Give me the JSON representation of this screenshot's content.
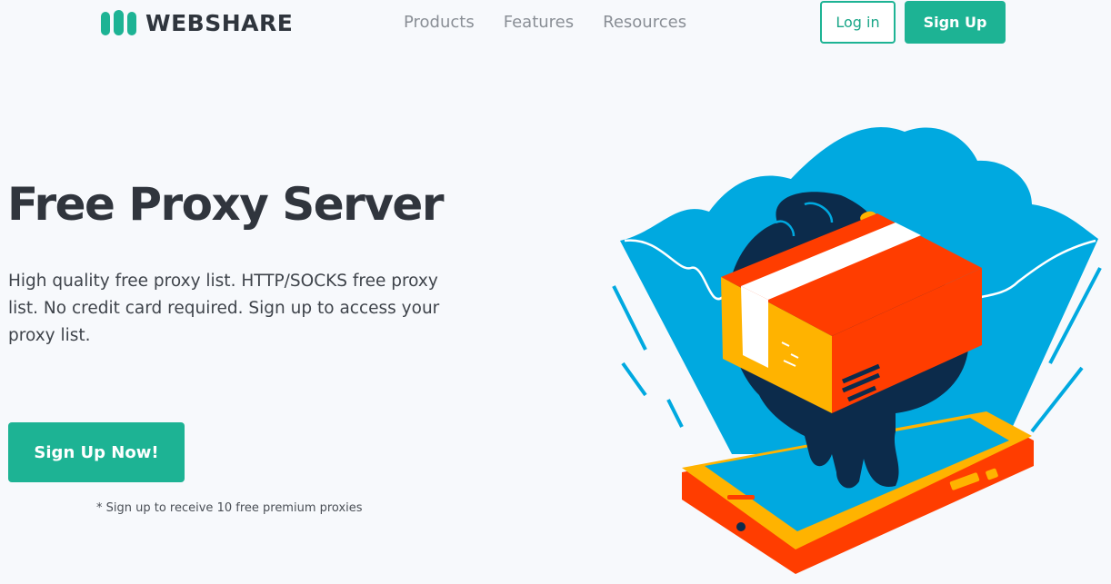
{
  "header": {
    "logo_text": "WEBSHARE",
    "nav": [
      "Products",
      "Features",
      "Resources"
    ],
    "login_label": "Log in",
    "signup_label": "Sign Up"
  },
  "hero": {
    "title": "Free Proxy Server",
    "description": "High quality free proxy list. HTTP/SOCKS free proxy list. No credit card required.  Sign up to access your proxy list.",
    "cta_label": "Sign Up Now!",
    "cta_note": "* Sign up to receive 10 free premium proxies"
  },
  "colors": {
    "brand": "#1db394",
    "text_dark": "#30353d",
    "nav_text": "#8a8f96",
    "illustration_sky": "#00a9e0",
    "illustration_orange": "#ff3d00",
    "illustration_yellow": "#ffb300",
    "illustration_navy": "#0c2b4b"
  },
  "illustration": {
    "icons": [
      "cloud-shape",
      "hand-icon",
      "package-box-icon",
      "tablet-device-icon"
    ]
  }
}
